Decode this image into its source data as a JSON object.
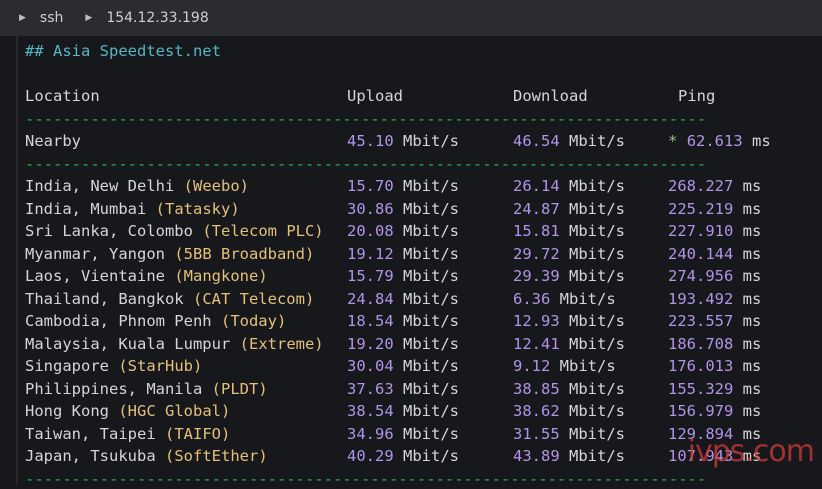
{
  "titlebar": {
    "session": "ssh",
    "host": "154.12.33.198"
  },
  "heading": "## Asia Speedtest.net",
  "columns": {
    "location": "Location",
    "upload": "Upload",
    "download": "Download",
    "ping": "Ping"
  },
  "separator": "-------------------------------------------------------------------------",
  "unit_speed": "Mbit/s",
  "unit_ping": "ms",
  "nearby": {
    "location": "Nearby",
    "upload": "45.10",
    "download": "46.54",
    "ping_marker": "*",
    "ping": "62.613"
  },
  "rows": [
    {
      "place": "India, New Delhi",
      "isp": "(Weebo)",
      "upload": "15.70",
      "download": "26.14",
      "ping": "268.227"
    },
    {
      "place": "India, Mumbai",
      "isp": "(Tatasky)",
      "upload": "30.86",
      "download": "24.87",
      "ping": "225.219"
    },
    {
      "place": "Sri Lanka, Colombo",
      "isp": "(Telecom PLC)",
      "upload": "20.08",
      "download": "15.81",
      "ping": "227.910"
    },
    {
      "place": "Myanmar, Yangon",
      "isp": "(5BB Broadband)",
      "upload": "19.12",
      "download": "29.72",
      "ping": "240.144"
    },
    {
      "place": "Laos, Vientaine",
      "isp": "(Mangkone)",
      "upload": "15.79",
      "download": "29.39",
      "ping": "274.956"
    },
    {
      "place": "Thailand, Bangkok",
      "isp": "(CAT Telecom)",
      "upload": "24.84",
      "download": "6.36",
      "ping": "193.492"
    },
    {
      "place": "Cambodia, Phnom Penh",
      "isp": "(Today)",
      "upload": "18.54",
      "download": "12.93",
      "ping": "223.557"
    },
    {
      "place": "Malaysia, Kuala Lumpur",
      "isp": "(Extreme)",
      "upload": "19.20",
      "download": "12.41",
      "ping": "186.708"
    },
    {
      "place": "Singapore",
      "isp": "(StarHub)",
      "upload": "30.04",
      "download": "9.12",
      "ping": "176.013"
    },
    {
      "place": "Philippines, Manila",
      "isp": "(PLDT)",
      "upload": "37.63",
      "download": "38.85",
      "ping": "155.329"
    },
    {
      "place": "Hong Kong",
      "isp": "(HGC Global)",
      "upload": "38.54",
      "download": "38.62",
      "ping": "156.979"
    },
    {
      "place": "Taiwan, Taipei",
      "isp": "(TAIFO)",
      "upload": "34.96",
      "download": "31.55",
      "ping": "129.894"
    },
    {
      "place": "Japan, Tsukuba",
      "isp": "(SoftEther)",
      "upload": "40.29",
      "download": "43.89",
      "ping": "107.943"
    }
  ],
  "watermark": "ivps.com",
  "colors": {
    "background": "#16181b",
    "heading": "#56b6c2",
    "separator": "#28b44f",
    "isp": "#e5c07b",
    "number": "#b294e8",
    "marker": "#98c379",
    "watermark": "#d73c3c"
  }
}
